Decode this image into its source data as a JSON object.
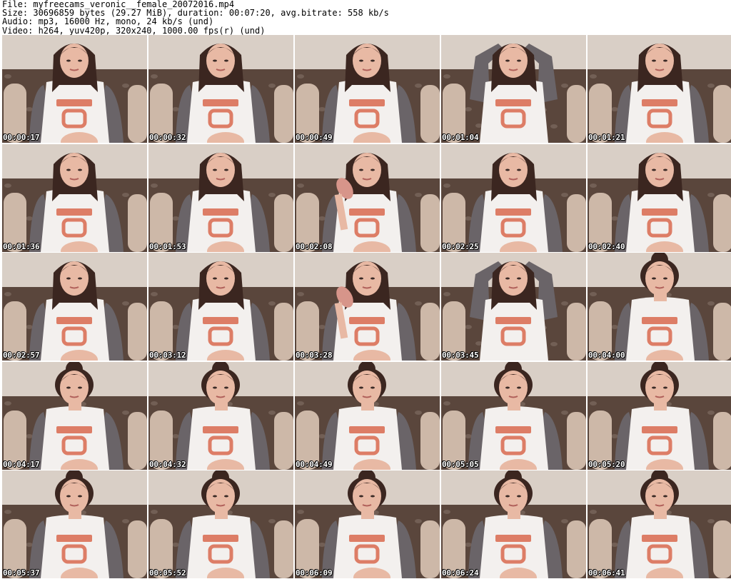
{
  "header": {
    "file_line": "File: myfreecams_veronic__female_20072016.mp4",
    "size_line": "Size: 30696859 bytes (29.27 MiB), duration: 00:07:20, avg.bitrate: 558 kb/s",
    "audio_line": "Audio: mp3, 16000 Hz, mono, 24 kb/s (und)",
    "video_line": "Video: h264, yuv420p, 320x240, 1000.00 fps(r) (und)"
  },
  "colors": {
    "wall": "#d9cfc6",
    "couch": "#5a463c",
    "armrest": "#cdb8a8",
    "hair": "#3b2620",
    "skin": "#e8b9a4",
    "shirt": "#f3f0ee",
    "sleeve": "#6a6468",
    "print": "#d8694e"
  },
  "thumbnails": [
    {
      "time": "00:00:17",
      "pose": "default"
    },
    {
      "time": "00:00:32",
      "pose": "default"
    },
    {
      "time": "00:00:49",
      "pose": "default"
    },
    {
      "time": "00:01:04",
      "pose": "arms-up"
    },
    {
      "time": "00:01:21",
      "pose": "default"
    },
    {
      "time": "00:01:36",
      "pose": "default"
    },
    {
      "time": "00:01:53",
      "pose": "default"
    },
    {
      "time": "00:02:08",
      "pose": "hand"
    },
    {
      "time": "00:02:25",
      "pose": "default"
    },
    {
      "time": "00:02:40",
      "pose": "default"
    },
    {
      "time": "00:02:57",
      "pose": "default"
    },
    {
      "time": "00:03:12",
      "pose": "default"
    },
    {
      "time": "00:03:28",
      "pose": "hand"
    },
    {
      "time": "00:03:45",
      "pose": "arms-up"
    },
    {
      "time": "00:04:00",
      "pose": "bun"
    },
    {
      "time": "00:04:17",
      "pose": "bun"
    },
    {
      "time": "00:04:32",
      "pose": "bun"
    },
    {
      "time": "00:04:49",
      "pose": "bun"
    },
    {
      "time": "00:05:05",
      "pose": "bun"
    },
    {
      "time": "00:05:20",
      "pose": "bun"
    },
    {
      "time": "00:05:37",
      "pose": "bun"
    },
    {
      "time": "00:05:52",
      "pose": "bun"
    },
    {
      "time": "00:06:09",
      "pose": "bun"
    },
    {
      "time": "00:06:24",
      "pose": "bun"
    },
    {
      "time": "00:06:41",
      "pose": "bun"
    }
  ]
}
